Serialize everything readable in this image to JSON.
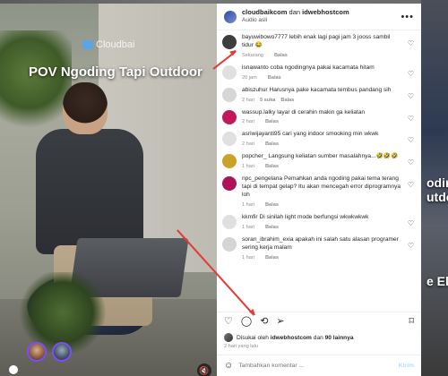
{
  "video": {
    "brand": "Cloudbai",
    "title": "POV Ngoding Tapi Outdoor"
  },
  "right_peek": {
    "lines": [
      "oding",
      "utdo",
      "e El"
    ]
  },
  "post": {
    "account": "cloudbaikcom",
    "connector": "dan",
    "collaborator": "idwebhostcom",
    "audio": "Audio asli",
    "more_icon": "more-horizontal-icon"
  },
  "comments": [
    {
      "user": "bayuwibowo7777",
      "text": "lebih enak lagi pagi jam 3 jooss sambil tidur 😂",
      "time": "Sekarang",
      "reply": "Balas",
      "likes": "",
      "avatar_color": "#3d3d3d"
    },
    {
      "user": "isnawanto",
      "text": "coba ngodingnya pakai kacamata hitam",
      "time": "20 jam",
      "reply": "Balas",
      "likes": "",
      "avatar_color": "#e0e0e0"
    },
    {
      "user": "abiszuhur",
      "text": "Harusnya pake kacamata tembus pandang sih",
      "time": "2 hari",
      "reply": "Balas",
      "likes": "5 suka",
      "avatar_color": "#d6d6d6"
    },
    {
      "user": "wassup.lalky",
      "text": "layar di cerahin makin ga keliatan",
      "time": "2 hari",
      "reply": "Balas",
      "likes": "",
      "avatar_color": "#c2185b"
    },
    {
      "user": "asriwijayanti95",
      "text": "cari yang indoor smooking min wkwk",
      "time": "2 hari",
      "reply": "Balas",
      "likes": "",
      "avatar_color": "#e0e0e0"
    },
    {
      "user": "popcher_",
      "text": "Langsung keliatan sumber masalahnya...🤣🤣🤣",
      "time": "1 hari",
      "reply": "Balas",
      "likes": "",
      "avatar_color": "#c9a227"
    },
    {
      "user": "npc_pengelana",
      "text": "Pemahkan anda ngoding pakai tema terang tapi di tempat gelap? Itu akan mencegah error diprogramnya loh",
      "time": "1 hari",
      "reply": "Balas",
      "likes": "",
      "avatar_color": "#ad1457"
    },
    {
      "user": "kkmfir",
      "text": "Di sinilah light mode berfungsi wkwkwkwk",
      "time": "1 hari",
      "reply": "Balas",
      "likes": "",
      "avatar_color": "#e0e0e0"
    },
    {
      "user": "soran_ibrahim_exia",
      "text": "apakah ini salah satu alasan programer sering kerja malam",
      "time": "1 hari",
      "reply": "Balas",
      "likes": "",
      "avatar_color": "#d4d4d4"
    }
  ],
  "actions": {
    "like_icon": "heart-icon",
    "comment_icon": "comment-icon",
    "repost_icon": "repost-icon",
    "share_icon": "send-icon",
    "save_icon": "bookmark-icon"
  },
  "likes": {
    "prefix": "Disukai oleh",
    "user": "idwebhostcom",
    "connector": "dan",
    "others": "90 lainnya"
  },
  "posted": "2 hari yang lalu",
  "add_comment": {
    "placeholder": "Tambahkan komentar ...",
    "post_label": "Kirim"
  },
  "colors": {
    "annotation_arrow": "#e53935",
    "post_button_disabled": "#b2dffc"
  }
}
